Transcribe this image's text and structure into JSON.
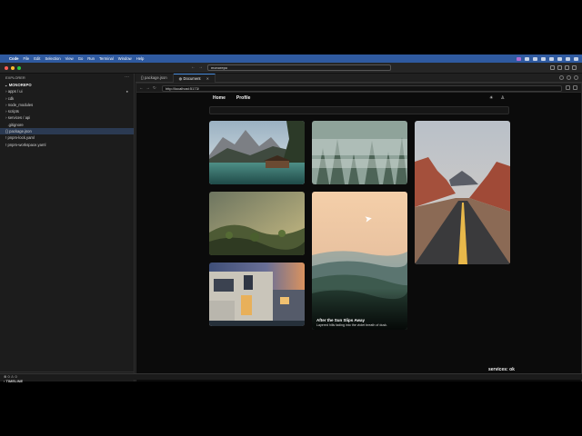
{
  "menubar": {
    "app": "Code",
    "items": [
      "File",
      "Edit",
      "Selection",
      "View",
      "Go",
      "Run",
      "Terminal",
      "Window",
      "Help"
    ]
  },
  "titlebar": {
    "command_center": "monorepo"
  },
  "sidebar": {
    "title": "EXPLORER",
    "root": "MONOREPO",
    "items": [
      {
        "label": "apps / ui",
        "badge": "●"
      },
      {
        "label": "cdk",
        "badge": ""
      },
      {
        "label": "node_modules",
        "badge": ""
      },
      {
        "label": "scripts",
        "badge": ""
      },
      {
        "label": "services / api",
        "badge": ""
      },
      {
        "label": ".gitignore",
        "badge": ""
      },
      {
        "label": "package.json",
        "badge": ""
      },
      {
        "label": "pnpm-lock.yaml",
        "badge": ""
      },
      {
        "label": "pnpm-workspace.yaml",
        "badge": ""
      }
    ],
    "outline": "OUTLINE",
    "timeline": "TIMELINE"
  },
  "tabs": [
    {
      "label": "package.json",
      "icon": "braces-icon"
    },
    {
      "label": "Document",
      "icon": "globe-icon"
    }
  ],
  "browser": {
    "url": "http://localhost:5173/"
  },
  "page": {
    "nav": [
      "Home",
      "Profile"
    ],
    "featured": {
      "title": "After the Sun Slips Away",
      "subtitle": "Layered hills fading into the violet breath of dusk."
    },
    "status": "services: ok"
  },
  "statusbar": {
    "text": "⊗ 0 ⚠ 0"
  },
  "colors": {
    "accent": "#2f5aa0",
    "selection": "#2b3a52",
    "tab_border": "#4a8fe0"
  }
}
